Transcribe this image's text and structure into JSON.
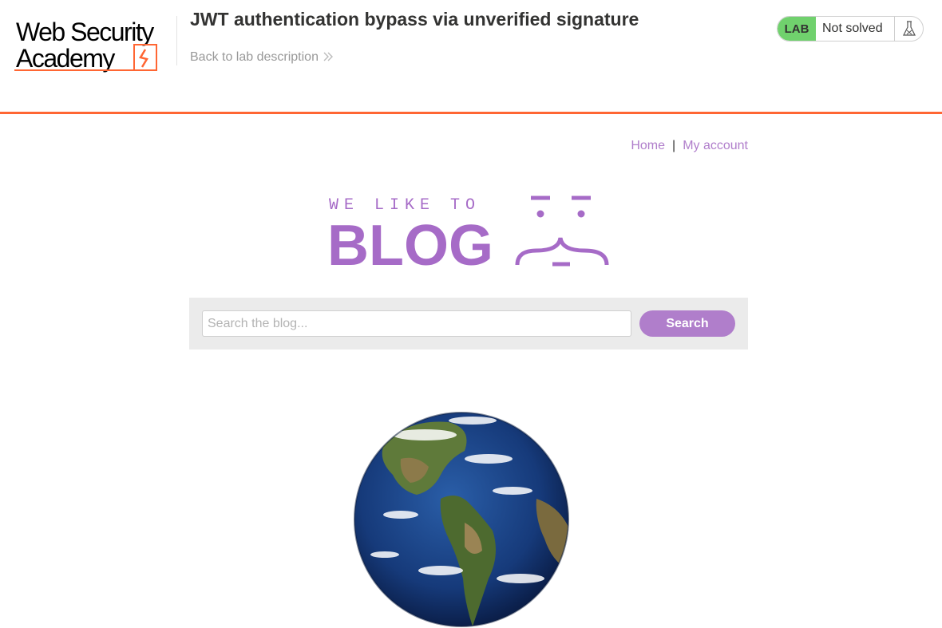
{
  "header": {
    "logo": {
      "line1": "Web Security",
      "line2": "Academy"
    },
    "lab_title": "JWT authentication bypass via unverified signature",
    "back_link": "Back to lab description",
    "status": {
      "badge": "LAB",
      "text": "Not solved",
      "icon": "flask-icon"
    },
    "accent_color": "#ff6633"
  },
  "nav": {
    "home": "Home",
    "separator": "|",
    "my_account": "My account"
  },
  "banner": {
    "tagline": "WE LIKE TO",
    "word": "BLOG",
    "color": "#a66bc7"
  },
  "search": {
    "placeholder": "Search the blog...",
    "value": "",
    "button": "Search"
  },
  "post": {
    "image": "earth-globe"
  },
  "colors": {
    "link": "#b07ecb",
    "lab_badge": "#70d16d"
  }
}
